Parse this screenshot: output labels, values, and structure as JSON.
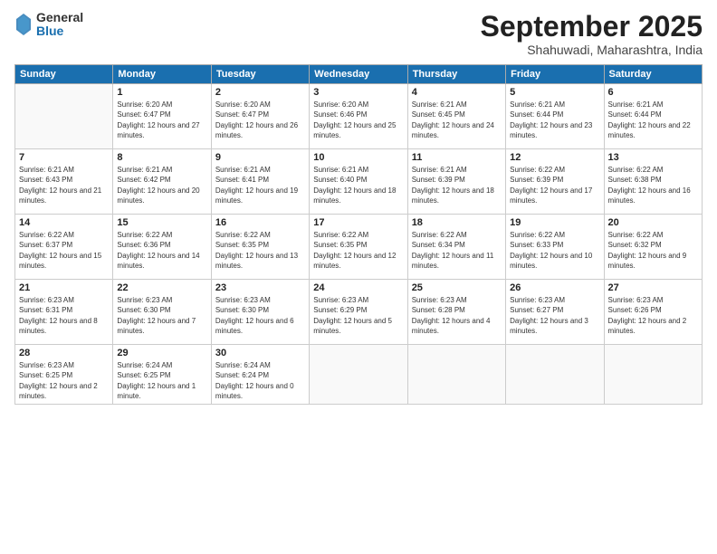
{
  "logo": {
    "general": "General",
    "blue": "Blue"
  },
  "title": "September 2025",
  "subtitle": "Shahuwadi, Maharashtra, India",
  "days": [
    "Sunday",
    "Monday",
    "Tuesday",
    "Wednesday",
    "Thursday",
    "Friday",
    "Saturday"
  ],
  "weeks": [
    [
      {
        "day": "",
        "sunrise": "",
        "sunset": "",
        "daylight": ""
      },
      {
        "day": "1",
        "sunrise": "Sunrise: 6:20 AM",
        "sunset": "Sunset: 6:47 PM",
        "daylight": "Daylight: 12 hours and 27 minutes."
      },
      {
        "day": "2",
        "sunrise": "Sunrise: 6:20 AM",
        "sunset": "Sunset: 6:47 PM",
        "daylight": "Daylight: 12 hours and 26 minutes."
      },
      {
        "day": "3",
        "sunrise": "Sunrise: 6:20 AM",
        "sunset": "Sunset: 6:46 PM",
        "daylight": "Daylight: 12 hours and 25 minutes."
      },
      {
        "day": "4",
        "sunrise": "Sunrise: 6:21 AM",
        "sunset": "Sunset: 6:45 PM",
        "daylight": "Daylight: 12 hours and 24 minutes."
      },
      {
        "day": "5",
        "sunrise": "Sunrise: 6:21 AM",
        "sunset": "Sunset: 6:44 PM",
        "daylight": "Daylight: 12 hours and 23 minutes."
      },
      {
        "day": "6",
        "sunrise": "Sunrise: 6:21 AM",
        "sunset": "Sunset: 6:44 PM",
        "daylight": "Daylight: 12 hours and 22 minutes."
      }
    ],
    [
      {
        "day": "7",
        "sunrise": "Sunrise: 6:21 AM",
        "sunset": "Sunset: 6:43 PM",
        "daylight": "Daylight: 12 hours and 21 minutes."
      },
      {
        "day": "8",
        "sunrise": "Sunrise: 6:21 AM",
        "sunset": "Sunset: 6:42 PM",
        "daylight": "Daylight: 12 hours and 20 minutes."
      },
      {
        "day": "9",
        "sunrise": "Sunrise: 6:21 AM",
        "sunset": "Sunset: 6:41 PM",
        "daylight": "Daylight: 12 hours and 19 minutes."
      },
      {
        "day": "10",
        "sunrise": "Sunrise: 6:21 AM",
        "sunset": "Sunset: 6:40 PM",
        "daylight": "Daylight: 12 hours and 18 minutes."
      },
      {
        "day": "11",
        "sunrise": "Sunrise: 6:21 AM",
        "sunset": "Sunset: 6:39 PM",
        "daylight": "Daylight: 12 hours and 18 minutes."
      },
      {
        "day": "12",
        "sunrise": "Sunrise: 6:22 AM",
        "sunset": "Sunset: 6:39 PM",
        "daylight": "Daylight: 12 hours and 17 minutes."
      },
      {
        "day": "13",
        "sunrise": "Sunrise: 6:22 AM",
        "sunset": "Sunset: 6:38 PM",
        "daylight": "Daylight: 12 hours and 16 minutes."
      }
    ],
    [
      {
        "day": "14",
        "sunrise": "Sunrise: 6:22 AM",
        "sunset": "Sunset: 6:37 PM",
        "daylight": "Daylight: 12 hours and 15 minutes."
      },
      {
        "day": "15",
        "sunrise": "Sunrise: 6:22 AM",
        "sunset": "Sunset: 6:36 PM",
        "daylight": "Daylight: 12 hours and 14 minutes."
      },
      {
        "day": "16",
        "sunrise": "Sunrise: 6:22 AM",
        "sunset": "Sunset: 6:35 PM",
        "daylight": "Daylight: 12 hours and 13 minutes."
      },
      {
        "day": "17",
        "sunrise": "Sunrise: 6:22 AM",
        "sunset": "Sunset: 6:35 PM",
        "daylight": "Daylight: 12 hours and 12 minutes."
      },
      {
        "day": "18",
        "sunrise": "Sunrise: 6:22 AM",
        "sunset": "Sunset: 6:34 PM",
        "daylight": "Daylight: 12 hours and 11 minutes."
      },
      {
        "day": "19",
        "sunrise": "Sunrise: 6:22 AM",
        "sunset": "Sunset: 6:33 PM",
        "daylight": "Daylight: 12 hours and 10 minutes."
      },
      {
        "day": "20",
        "sunrise": "Sunrise: 6:22 AM",
        "sunset": "Sunset: 6:32 PM",
        "daylight": "Daylight: 12 hours and 9 minutes."
      }
    ],
    [
      {
        "day": "21",
        "sunrise": "Sunrise: 6:23 AM",
        "sunset": "Sunset: 6:31 PM",
        "daylight": "Daylight: 12 hours and 8 minutes."
      },
      {
        "day": "22",
        "sunrise": "Sunrise: 6:23 AM",
        "sunset": "Sunset: 6:30 PM",
        "daylight": "Daylight: 12 hours and 7 minutes."
      },
      {
        "day": "23",
        "sunrise": "Sunrise: 6:23 AM",
        "sunset": "Sunset: 6:30 PM",
        "daylight": "Daylight: 12 hours and 6 minutes."
      },
      {
        "day": "24",
        "sunrise": "Sunrise: 6:23 AM",
        "sunset": "Sunset: 6:29 PM",
        "daylight": "Daylight: 12 hours and 5 minutes."
      },
      {
        "day": "25",
        "sunrise": "Sunrise: 6:23 AM",
        "sunset": "Sunset: 6:28 PM",
        "daylight": "Daylight: 12 hours and 4 minutes."
      },
      {
        "day": "26",
        "sunrise": "Sunrise: 6:23 AM",
        "sunset": "Sunset: 6:27 PM",
        "daylight": "Daylight: 12 hours and 3 minutes."
      },
      {
        "day": "27",
        "sunrise": "Sunrise: 6:23 AM",
        "sunset": "Sunset: 6:26 PM",
        "daylight": "Daylight: 12 hours and 2 minutes."
      }
    ],
    [
      {
        "day": "28",
        "sunrise": "Sunrise: 6:23 AM",
        "sunset": "Sunset: 6:25 PM",
        "daylight": "Daylight: 12 hours and 2 minutes."
      },
      {
        "day": "29",
        "sunrise": "Sunrise: 6:24 AM",
        "sunset": "Sunset: 6:25 PM",
        "daylight": "Daylight: 12 hours and 1 minute."
      },
      {
        "day": "30",
        "sunrise": "Sunrise: 6:24 AM",
        "sunset": "Sunset: 6:24 PM",
        "daylight": "Daylight: 12 hours and 0 minutes."
      },
      {
        "day": "",
        "sunrise": "",
        "sunset": "",
        "daylight": ""
      },
      {
        "day": "",
        "sunrise": "",
        "sunset": "",
        "daylight": ""
      },
      {
        "day": "",
        "sunrise": "",
        "sunset": "",
        "daylight": ""
      },
      {
        "day": "",
        "sunrise": "",
        "sunset": "",
        "daylight": ""
      }
    ]
  ]
}
